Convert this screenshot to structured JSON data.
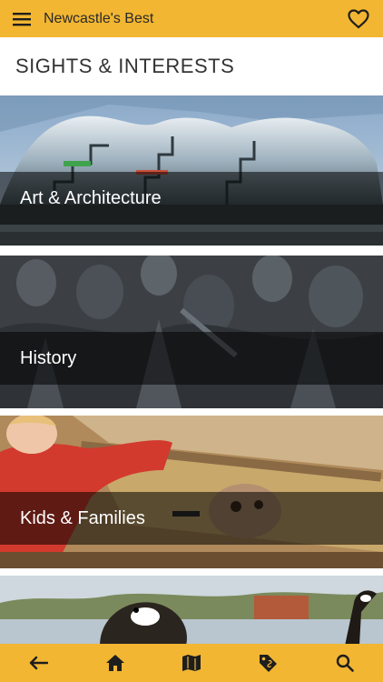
{
  "colors": {
    "accent": "#f2b632",
    "icon": "#1e1e1e",
    "band": "rgba(0,0,0,0.55)"
  },
  "header": {
    "title": "Newcastle's Best",
    "menu_icon": "menu-icon",
    "favorite_icon": "heart-icon"
  },
  "section": {
    "title": "SIGHTS & INTERESTS"
  },
  "categories": [
    {
      "label": "Art & Architecture",
      "image": "sage-gateshead-building"
    },
    {
      "label": "History",
      "image": "bronze-soldiers-sculpture"
    },
    {
      "label": "Kids & Families",
      "image": "child-at-dig-pit-with-skull"
    },
    {
      "label": "",
      "image": "canada-goose-riverside"
    }
  ],
  "bottom_nav": [
    {
      "icon": "back-arrow-icon"
    },
    {
      "icon": "home-icon"
    },
    {
      "icon": "map-icon"
    },
    {
      "icon": "tag-icon"
    },
    {
      "icon": "search-icon"
    }
  ]
}
